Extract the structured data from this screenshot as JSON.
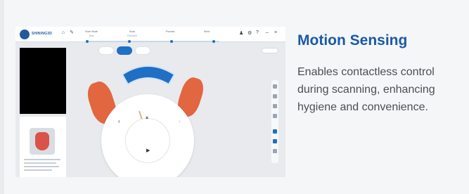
{
  "feature": {
    "title": "Motion Sensing",
    "description": "Enables contactless control during scanning, enhancing hygiene and convenience."
  },
  "screenshot": {
    "app": {
      "logo_text": "SHINING3D"
    },
    "steps": [
      {
        "label": "Scan Mode",
        "sub": "Oral"
      },
      {
        "label": "Scan",
        "sub": "Full Arch"
      },
      {
        "label": "Process",
        "sub": ""
      },
      {
        "label": "Send",
        "sub": ""
      }
    ],
    "icons": [
      "home-icon",
      "settings-icon",
      "help-icon",
      "close-icon"
    ],
    "colors": {
      "accent": "#1f6fc5",
      "title": "#1a5aa6",
      "scan": "#e2663f"
    }
  }
}
